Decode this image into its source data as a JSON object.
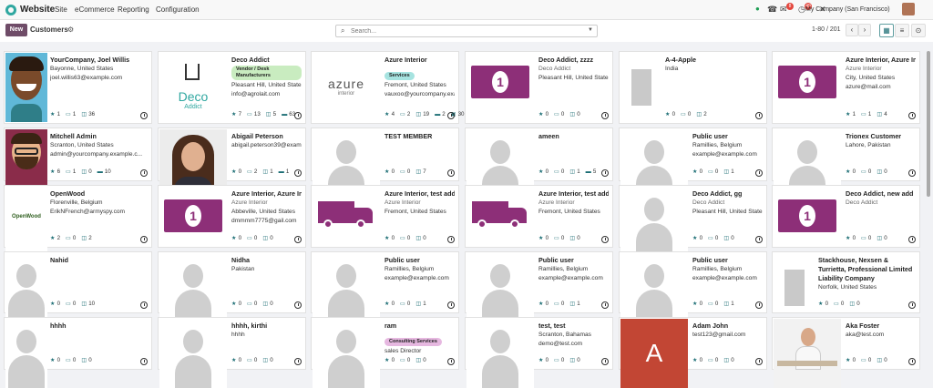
{
  "app": {
    "name": "Website",
    "menu": [
      "Site",
      "eCommerce",
      "Reporting",
      "Configuration"
    ]
  },
  "topbar": {
    "company": "My Company (San Francisco)",
    "chat_badge": "8",
    "activity_badge": "49"
  },
  "control": {
    "new_label": "New",
    "breadcrumb": "Customers",
    "search_placeholder": "Search...",
    "pager": "1-80 / 201"
  },
  "cards": [
    {
      "name": "YourCompany, Joel Willis",
      "lines": [
        "Bayonne, United States",
        "joel.willis63@example.com"
      ],
      "stats": [
        "1",
        "1",
        "36"
      ],
      "img": "photo-joel"
    },
    {
      "name": "Deco Addict",
      "tag": "Vendor / Desk Manufacturers",
      "tag_color": "#c9ecc0",
      "lines": [
        "Pleasant Hill, United States",
        "info@agrolait.com"
      ],
      "stats": [
        "7",
        "13",
        "5",
        "63"
      ],
      "img": "deco-logo",
      "logo_text": "Deco",
      "logo_sub": "Addict"
    },
    {
      "name": "Azure Interior",
      "tag": "Services",
      "tag_color": "#a6e3e0",
      "lines": [
        "Fremont, United States",
        "vauxoo@yourcompany.example..."
      ],
      "stats": [
        "4",
        "2",
        "19",
        "2",
        "30"
      ],
      "img": "azure-logo",
      "logo_text": "azure",
      "logo_sub": "interior"
    },
    {
      "name": "Deco Addict, zzzz",
      "muted": "Deco Addict",
      "lines": [
        "Pleasant Hill, United States"
      ],
      "stats": [
        "0",
        "0",
        "0"
      ],
      "img": "money"
    },
    {
      "name": "A-4-Apple",
      "lines": [
        "India"
      ],
      "stats": [
        "0",
        "0",
        "2"
      ],
      "img": "building"
    },
    {
      "name": "Azure Interior, Azure Interior",
      "muted": "Azure Interior",
      "lines": [
        "City, United States",
        "azure@mail.com"
      ],
      "stats": [
        "1",
        "1",
        "4"
      ],
      "img": "money"
    },
    {
      "name": "Mitchell Admin",
      "lines": [
        "Scranton, United States",
        "admin@yourcompany.example.c..."
      ],
      "stats": [
        "6",
        "1",
        "0",
        "10"
      ],
      "img": "photo-mitchell"
    },
    {
      "name": "Abigail Peterson",
      "lines": [
        "abigail.peterson39@example.com"
      ],
      "stats": [
        "0",
        "2",
        "1",
        "1"
      ],
      "img": "photo-abigail"
    },
    {
      "name": "TEST MEMBER",
      "lines": [],
      "stats": [
        "0",
        "0",
        "7"
      ],
      "img": "person"
    },
    {
      "name": "ameen",
      "lines": [],
      "stats": [
        "0",
        "0",
        "1",
        "5"
      ],
      "img": "person"
    },
    {
      "name": "Public user",
      "lines": [
        "Ramillies, Belgium",
        "example@example.com"
      ],
      "stats": [
        "0",
        "0",
        "1"
      ],
      "img": "person"
    },
    {
      "name": "Trionex Customer",
      "lines": [
        "Lahore, Pakistan"
      ],
      "stats": [
        "0",
        "0",
        "0"
      ],
      "img": "person"
    },
    {
      "name": "OpenWood",
      "lines": [
        "Florenville, Belgium",
        "ErikNFrench@armyspy.com"
      ],
      "stats": [
        "2",
        "0",
        "2"
      ],
      "img": "openwood-logo",
      "logo_text": "OpenWood"
    },
    {
      "name": "Azure Interior, Azure Interior",
      "muted": "Azure Interior",
      "lines": [
        "Abbeville, United States",
        "dmmmm7775@gail.com"
      ],
      "stats": [
        "0",
        "0",
        "0"
      ],
      "img": "money"
    },
    {
      "name": "Azure Interior, test address 1",
      "muted": "Azure Interior",
      "lines": [
        "Fremont, United States"
      ],
      "stats": [
        "0",
        "0",
        "0"
      ],
      "img": "truck"
    },
    {
      "name": "Azure Interior, test address 2",
      "muted": "Azure Interior",
      "lines": [
        "Fremont, United States"
      ],
      "stats": [
        "0",
        "0",
        "0"
      ],
      "img": "truck"
    },
    {
      "name": "Deco Addict, gg",
      "muted": "Deco Addict",
      "lines": [
        "Pleasant Hill, United States"
      ],
      "stats": [
        "0",
        "0",
        "0"
      ],
      "img": "person"
    },
    {
      "name": "Deco Addict, new add",
      "muted": "Deco Addict",
      "lines": [],
      "stats": [
        "0",
        "0",
        "0"
      ],
      "img": "money"
    },
    {
      "name": "Nahid",
      "lines": [],
      "stats": [
        "0",
        "0",
        "10"
      ],
      "img": "person"
    },
    {
      "name": "Nidha",
      "lines": [
        "Pakistan"
      ],
      "stats": [
        "0",
        "0",
        "0"
      ],
      "img": "person"
    },
    {
      "name": "Public user",
      "lines": [
        "Ramillies, Belgium",
        "example@example.com"
      ],
      "stats": [
        "0",
        "0",
        "1"
      ],
      "img": "person"
    },
    {
      "name": "Public user",
      "lines": [
        "Ramillies, Belgium",
        "example@example.com"
      ],
      "stats": [
        "0",
        "0",
        "1"
      ],
      "img": "person"
    },
    {
      "name": "Public user",
      "lines": [
        "Ramillies, Belgium",
        "example@example.com"
      ],
      "stats": [
        "0",
        "0",
        "1"
      ],
      "img": "person"
    },
    {
      "name": "Stackhouse, Nexsen & Turrietta, Professional Limited Liability Company",
      "wrap": true,
      "lines": [
        "Norfolk, United States"
      ],
      "stats": [
        "0",
        "0",
        "0"
      ],
      "img": "building"
    },
    {
      "name": "hhhh",
      "lines": [],
      "stats": [
        "0",
        "0",
        "0"
      ],
      "img": "person"
    },
    {
      "name": "hhhh, kirthi",
      "lines": [
        "hhhh"
      ],
      "stats": [
        "0",
        "0",
        "0"
      ],
      "img": "person"
    },
    {
      "name": "ram",
      "tag": "Consulting Services",
      "tag_color": "#e6b8e0",
      "lines": [
        "sales Director"
      ],
      "stats": [
        "0",
        "0",
        "0"
      ],
      "img": "person"
    },
    {
      "name": "test, test",
      "lines": [
        "Scranton, Bahamas",
        "demo@test.com"
      ],
      "stats": [
        "0",
        "0",
        "0"
      ],
      "img": "person"
    },
    {
      "name": "Adam John",
      "lines": [
        "test123@gmail.com"
      ],
      "stats": [
        "0",
        "0",
        "0"
      ],
      "img": "letter-a",
      "letter": "A"
    },
    {
      "name": "Aka Foster",
      "lines": [
        "aka@test.com"
      ],
      "stats": [
        "0",
        "0",
        "0"
      ],
      "img": "photo-aka"
    }
  ]
}
